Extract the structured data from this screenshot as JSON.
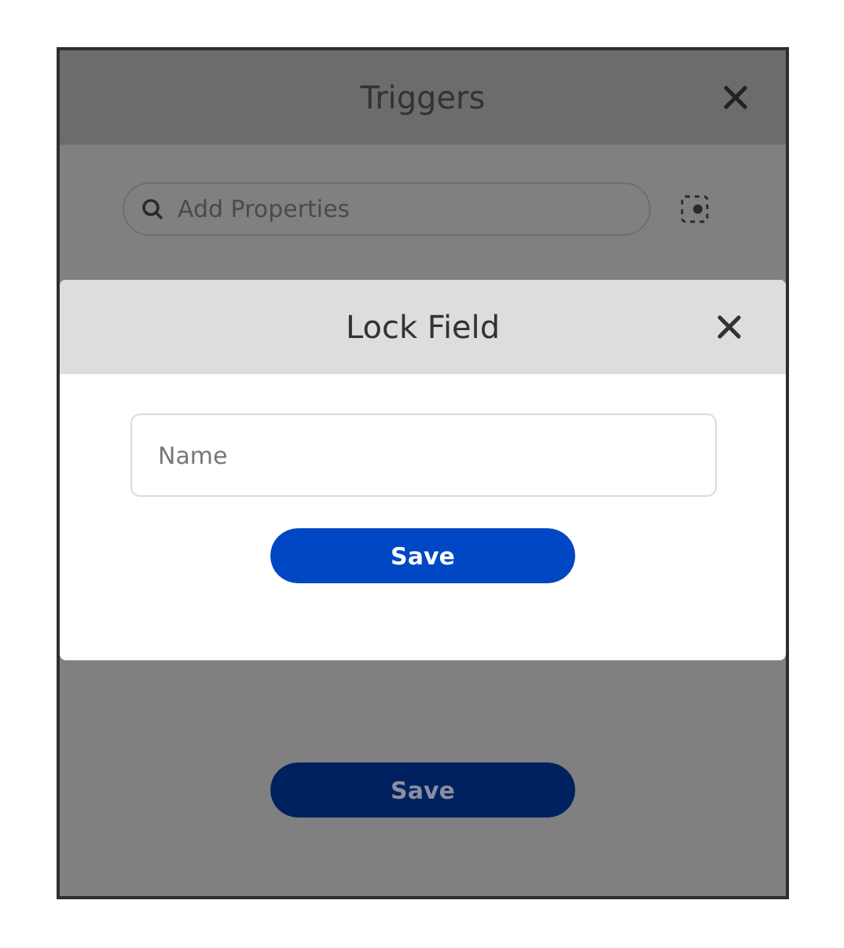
{
  "panel": {
    "title": "Triggers",
    "search": {
      "placeholder": "Add Properties"
    },
    "save_button": "Save"
  },
  "dialog": {
    "title": "Lock Field",
    "name_field": {
      "placeholder": "Name"
    },
    "save_button": "Save"
  }
}
